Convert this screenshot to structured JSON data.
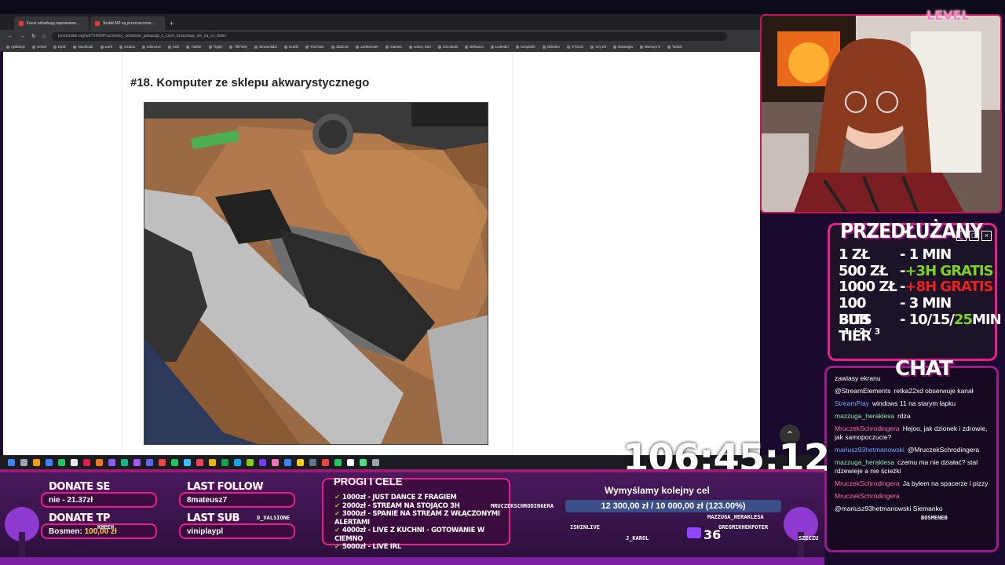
{
  "browser": {
    "tabs": [
      {
        "label": "Facet odradzają naprawowe..."
      },
      {
        "label": "Śrubki M2 są przeznaczone..."
      }
    ],
    "url": "joemonster.org/art/71409/Pracownicy_serwisow_pokazuja_z_czym_korzystaja_sie_na_co_dzien",
    "bookmarks": [
      "Aplikacje",
      "Gmail",
      "Dysk",
      "Facebook",
      "work",
      "Oculus",
      "IshinLive",
      "Kick",
      "Twitter",
      "Tipply",
      "TikFinity",
      "Streamlabs",
      "Grafik",
      "YouTube",
      "JBZD.pl",
      "JoeMonster",
      "Games",
      "Łowcy Gier",
      "GG.deals",
      "Behance",
      "LinkedIn",
      "Unsplash",
      "Skinden",
      "STOCK",
      "Gry tnt",
      "Norwegia",
      "Memory 5",
      "Twitch"
    ]
  },
  "article": {
    "heading": "#18. Komputer ze sklepu akwarystycznego"
  },
  "timer": "106:45:12",
  "logo": "LEVEL",
  "extension_panel": {
    "title": "PRZEDŁUŻANY",
    "rows": [
      {
        "key": "1 ZŁ",
        "value": "- 1 MIN",
        "accent": ""
      },
      {
        "key": "500 ZŁ",
        "value": "- ",
        "accent": "+3H GRATIS",
        "accent_color": "#7ed321"
      },
      {
        "key": "1000 ZŁ",
        "value": "- ",
        "accent": "+8H GRATIS",
        "accent_color": "#e82020"
      },
      {
        "key": "100 BITS",
        "value": "- 3 MIN",
        "accent": ""
      },
      {
        "key": "SUB TIER",
        "value": "- 10/15/",
        "accent": "25",
        "accent_color": "#7ed321",
        "suffix": " MIN"
      }
    ],
    "sub_tiers": "1 / 2 / 3"
  },
  "chat": {
    "title": "CHAT",
    "messages": [
      {
        "user": "",
        "text": "zawiasy ekranu",
        "color": "g"
      },
      {
        "user": "@StreamElements",
        "text": "retka22xd obserwuje kanał",
        "color": "w"
      },
      {
        "user": "StreamPlay",
        "text": "windows 11 na starym lapku",
        "color": "b"
      },
      {
        "user": "mazzuga_heraklesa",
        "text": "rdza",
        "color": "g"
      },
      {
        "user": "MruczekSchrodingera",
        "text": "Hejoo, jak dzionek i zdrowie, jak samopoczucie?",
        "color": "p"
      },
      {
        "user": "mariusz93hetmanowski",
        "text": "@MruczekSchrodingera",
        "color": "b"
      },
      {
        "user": "mazzuga_heraklesa",
        "text": "czemu ma nie działać? stal rdzewieje a nie ścieżki",
        "color": "g"
      },
      {
        "user": "MruczekSchrodingera",
        "text": "Ja byłem na spacerze i pizzy",
        "color": "p"
      },
      {
        "user": "MruczekSchrodingera",
        "text": "",
        "color": "p"
      },
      {
        "user": "",
        "text": "@mariusz93hetmanowski Siemanko",
        "color": "w"
      }
    ]
  },
  "donate_se": {
    "label": "DONATE SE",
    "value": "nie - 21.37zł"
  },
  "donate_tp": {
    "label": "DONATE TP",
    "value_name": "Bosmen:",
    "value_amount": "100,00 zł"
  },
  "last_follow": {
    "label": "LAST FOLLOW",
    "value": "8mateusz7"
  },
  "last_sub": {
    "label": "LAST SUB",
    "value": "viniplaypl"
  },
  "progi": {
    "title": "PROGI I CELE",
    "items": [
      "1000zł - JUST DANCE Z FRAGIEM",
      "2000zł - STREAM NA STOJĄCO 3H",
      "3000zł - SPANIE NA STREAM Z WŁĄCZONYMI ALERTAMI",
      "4000zł - LIVE Z KUCHNI - GOTOWANIE W CIEMNO",
      "5000zł - LIVE IRL"
    ]
  },
  "goal": {
    "title": "Wymyślamy kolejny cel",
    "progress_text": "12 300,00 zł / 10 000,00 zł (123.00%)",
    "progress_fraction": 1.0
  },
  "viewer_count": "36",
  "viewer_names": [
    "MRUCZEKSCHRODINGERA",
    "ISHINLIVE",
    "J_KAROL",
    "MAZZUGA_HERAKLESA",
    "GREGMIKHEKPOTER",
    "SZECZU",
    "BOSMENEB",
    "D_VALSIONE",
    "KMPEH"
  ]
}
